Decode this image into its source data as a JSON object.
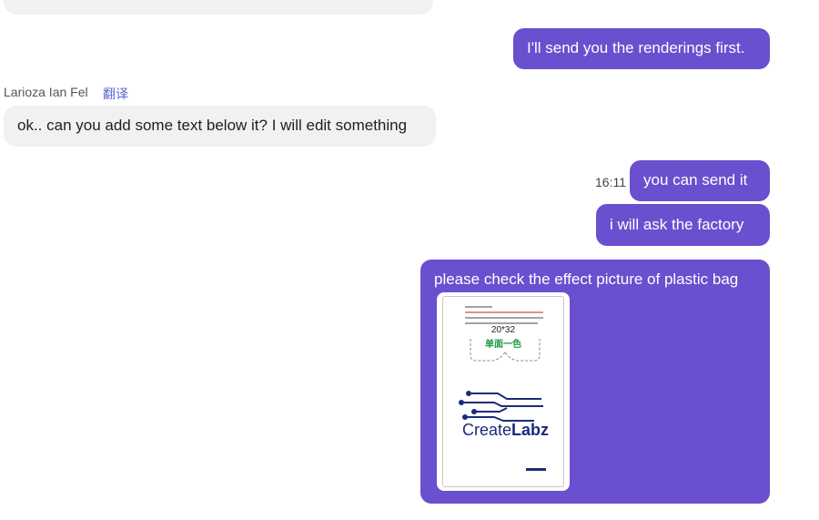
{
  "messages": [
    {
      "text": ""
    },
    {
      "text": "I'll send you the renderings first."
    },
    {
      "sender": "Larioza Ian Fel",
      "translate_label": "翻译",
      "text": "ok.. can you add some text below it? I will edit something"
    },
    {
      "time": "16:11",
      "text": "you can send it"
    },
    {
      "text": "i will ask the factory"
    },
    {
      "text": "please check the effect picture of plastic bag"
    }
  ],
  "image": {
    "size_label": "20*32",
    "print_label": "单面一色",
    "logo_part1": "Create",
    "logo_part2": "Labz"
  },
  "colors": {
    "outgoing_bubble": "#6a4fcf",
    "incoming_bubble": "#f1f1f2",
    "translate_link": "#5b67d8",
    "logo": "#1d2a7a"
  }
}
